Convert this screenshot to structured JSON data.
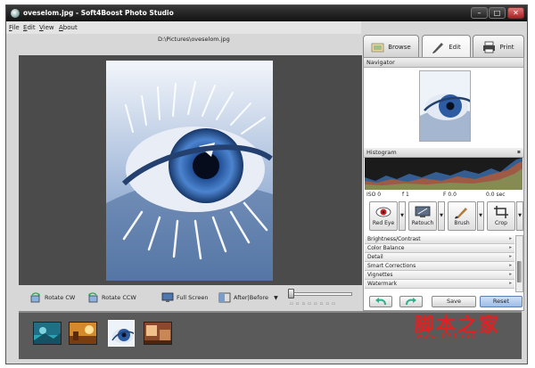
{
  "window": {
    "title": "oveselom.jpg - Soft4Boost Photo Studio",
    "minimize_label": "–",
    "maximize_label": "□",
    "close_label": "✕"
  },
  "menu": {
    "file": "File",
    "edit": "Edit",
    "view": "View",
    "about": "About"
  },
  "file_path": "D:\\Pictures\\oveselom.jpg",
  "bottom_toolbar": {
    "rotate_cw": "Rotate CW",
    "rotate_ccw": "Rotate CCW",
    "full_screen": "Full Screen",
    "after_before": "After|Before"
  },
  "tabs": {
    "browse": "Browse",
    "edit": "Edit",
    "print": "Print"
  },
  "panel": {
    "navigator_title": "Navigator",
    "histogram_title": "Histogram",
    "histogram_readout": {
      "iso": "ISO 0",
      "f_number": "f 1",
      "focal": "F 0.0",
      "shutter": "0.0 sec"
    },
    "tools": {
      "red_eye": "Red Eye",
      "retouch": "Retouch",
      "brush": "Brush",
      "crop": "Crop"
    },
    "adjustments": [
      "Brightness/Contrast",
      "Color Balance",
      "Detail",
      "Smart Corrections",
      "Vignettes",
      "Watermark"
    ],
    "save_label": "Save",
    "reset_label": "Reset"
  },
  "watermark": {
    "chinese": "脚本之家",
    "url": "www.jb51.net"
  },
  "colors": {
    "viewer_background": "#4b4b4b",
    "strip_background": "#5a5a5a",
    "reset_button": "#9bbbe6",
    "watermark": "#dd2222"
  },
  "icons": {
    "app": "photo-studio-logo-icon",
    "rotate_cw": "rotate-clockwise-icon",
    "rotate_ccw": "rotate-counterclockwise-icon",
    "full_screen": "monitor-icon",
    "after_before": "split-view-icon",
    "browse": "folder-browse-icon",
    "edit": "pencil-icon",
    "print": "printer-icon",
    "red_eye": "eye-icon",
    "retouch": "retouch-monitor-icon",
    "brush": "brush-icon",
    "crop": "crop-icon",
    "undo": "undo-arrow-icon",
    "redo": "redo-arrow-icon"
  }
}
